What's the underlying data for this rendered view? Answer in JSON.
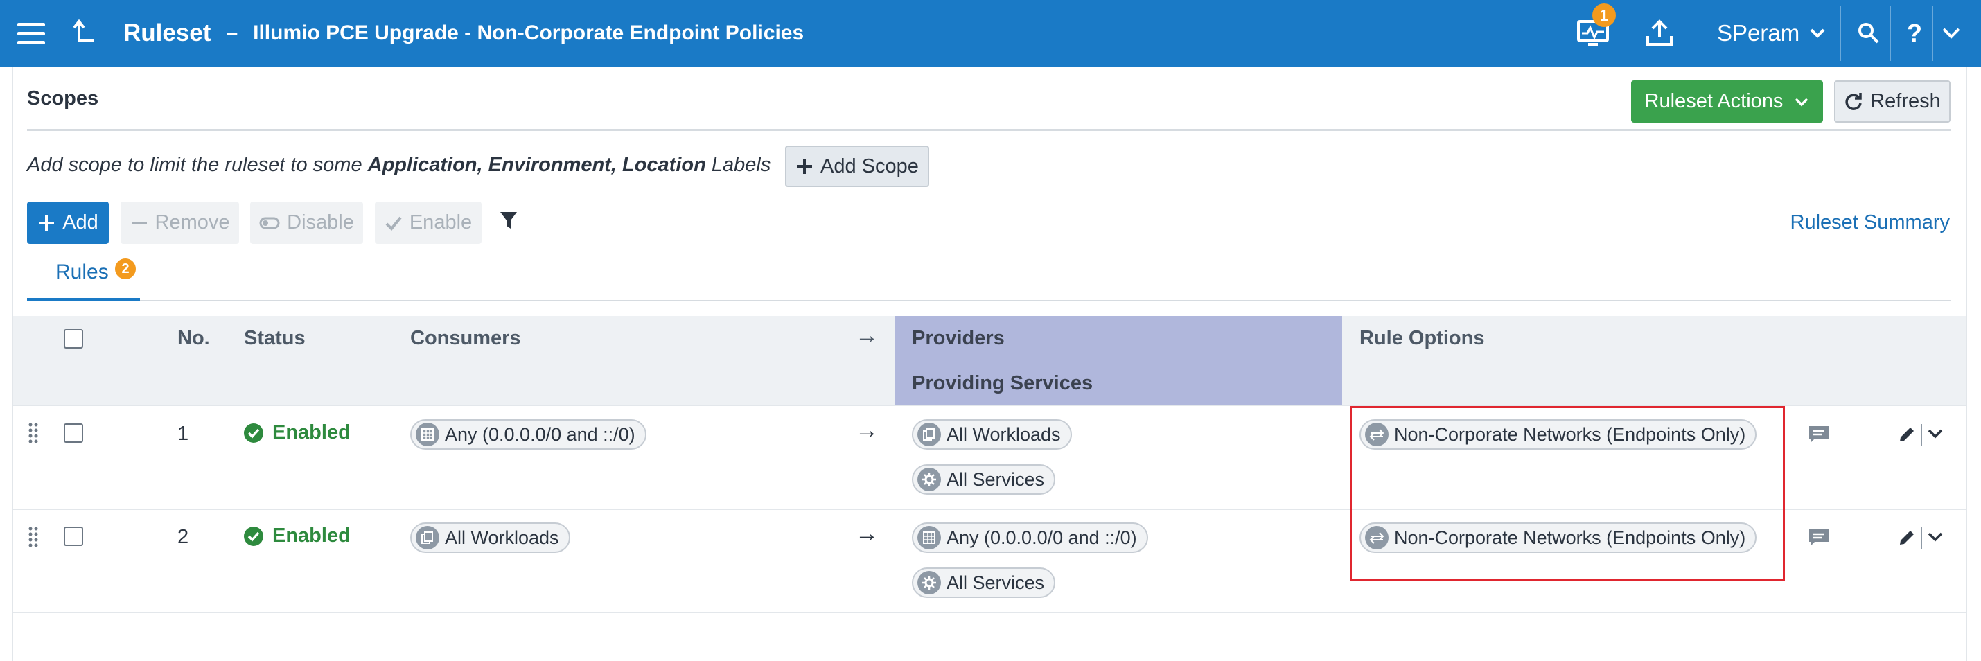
{
  "header": {
    "title": "Ruleset",
    "dash": "–",
    "subtitle": "Illumio PCE Upgrade - Non-Corporate Endpoint Policies",
    "notification_count": "1",
    "user": "SPeram",
    "help": "?"
  },
  "scopes": {
    "title": "Scopes",
    "actions_label": "Ruleset Actions",
    "refresh_label": "Refresh",
    "hint_prefix": "Add scope to limit the ruleset to some ",
    "hint_bold": "Application, Environment, Location",
    "hint_suffix": " Labels",
    "add_scope_label": "Add Scope"
  },
  "toolbar": {
    "add": "Add",
    "remove": "Remove",
    "disable": "Disable",
    "enable": "Enable",
    "summary": "Ruleset Summary"
  },
  "tabs": {
    "rules_label": "Rules",
    "rules_count": "2"
  },
  "table": {
    "headers": {
      "no": "No.",
      "status": "Status",
      "consumers": "Consumers",
      "arrow": "→",
      "providers": "Providers",
      "providing_services": "Providing Services",
      "rule_options": "Rule Options"
    },
    "rows": [
      {
        "no": "1",
        "status": "Enabled",
        "consumers": [
          "Any (0.0.0.0/0 and ::/0)"
        ],
        "providers": [
          "All Workloads"
        ],
        "services": [
          "All Services"
        ],
        "option": "Non-Corporate Networks (Endpoints Only)"
      },
      {
        "no": "2",
        "status": "Enabled",
        "consumers": [
          "All Workloads"
        ],
        "providers": [
          "Any (0.0.0.0/0 and ::/0)"
        ],
        "services": [
          "All Services"
        ],
        "option": "Non-Corporate Networks (Endpoints Only)"
      }
    ]
  },
  "colors": {
    "header_blue": "#1a7ac6",
    "green": "#3aa24d",
    "enabled_green": "#2e8a3e",
    "providers_bg": "#b0b7dc",
    "badge_orange": "#f39a1e",
    "highlight_red": "#e0262f"
  },
  "icons": {
    "menu": "hamburger-icon",
    "up": "up-arrow-icon",
    "monitor": "monitor-icon",
    "upload": "upload-icon",
    "search": "search-icon",
    "filter": "filter-icon",
    "comment": "comment-icon",
    "edit": "pencil-icon"
  }
}
